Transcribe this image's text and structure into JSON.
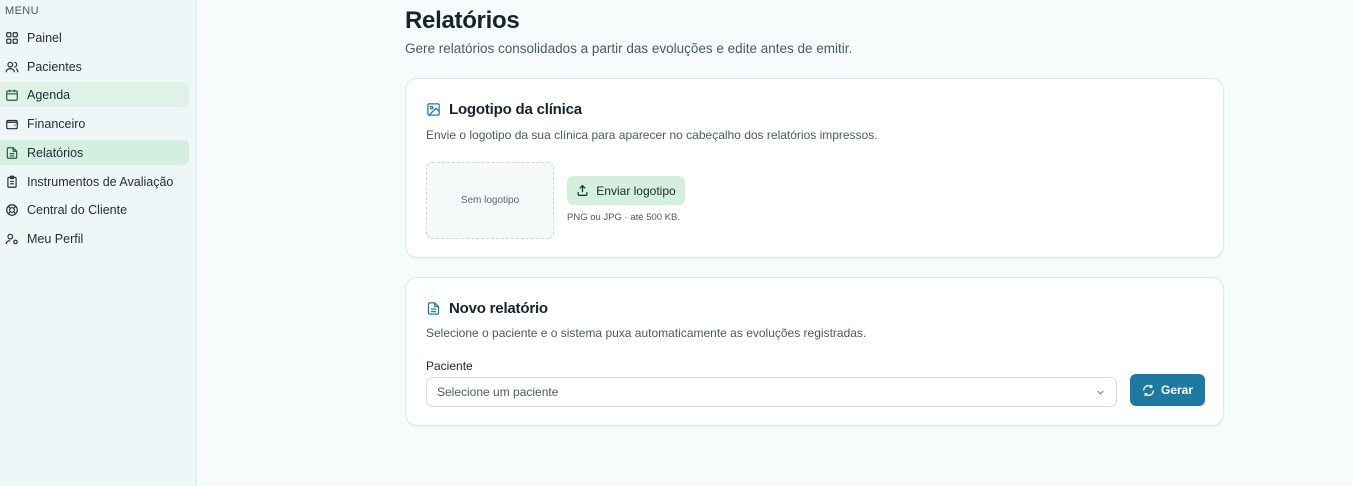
{
  "sidebar": {
    "menu_label": "MENU",
    "items": [
      {
        "label": "Painel",
        "icon": "grid-icon"
      },
      {
        "label": "Pacientes",
        "icon": "users-icon"
      },
      {
        "label": "Agenda",
        "icon": "calendar-icon"
      },
      {
        "label": "Financeiro",
        "icon": "wallet-icon"
      },
      {
        "label": "Relatórios",
        "icon": "file-text-icon"
      },
      {
        "label": "Instrumentos de Avaliação",
        "icon": "clipboard-icon"
      },
      {
        "label": "Central do Cliente",
        "icon": "lifebuoy-icon"
      },
      {
        "label": "Meu Perfil",
        "icon": "user-cog-icon"
      }
    ],
    "active_item": "Relatórios"
  },
  "page": {
    "title": "Relatórios",
    "subtitle": "Gere relatórios consolidados a partir das evoluções e edite antes de emitir."
  },
  "logo_card": {
    "title": "Logotipo da clínica",
    "icon": "image-icon",
    "description": "Envie o logotipo da sua clínica para aparecer no cabeçalho dos relatórios impressos.",
    "placeholder": "Sem logotipo",
    "upload_label": "Enviar logotipo",
    "hint": "PNG ou JPG · até 500 KB."
  },
  "report_card": {
    "title": "Novo relatório",
    "icon": "file-icon",
    "description": "Selecione o paciente e o sistema puxa automaticamente as evoluções registradas.",
    "field_label": "Paciente",
    "select_placeholder": "Selecione um paciente",
    "generate_label": "Gerar"
  },
  "colors": {
    "primary": "#1d7aa0",
    "accent_soft": "#d4efe0",
    "sidebar_bg": "#eef6f7",
    "page_bg": "#f6fcfb"
  }
}
